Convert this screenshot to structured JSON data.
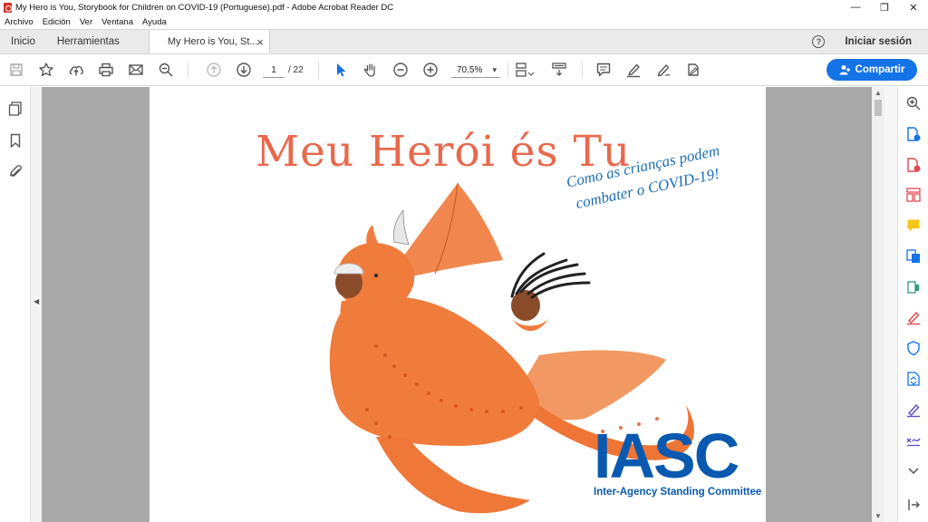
{
  "window": {
    "title": "My Hero is You, Storybook for Children on COVID-19 (Portuguese).pdf - Adobe Acrobat Reader DC",
    "minimize_glyph": "—",
    "restore_glyph": "❐",
    "close_glyph": "✕"
  },
  "menu": [
    "Archivo",
    "Edición",
    "Ver",
    "Ventana",
    "Ayuda"
  ],
  "tabs": {
    "home": "Inicio",
    "tools": "Herramientas",
    "document": "My Hero is You, St...",
    "close_glyph": "×",
    "help_glyph": "?",
    "sign_in": "Iniciar sesión"
  },
  "toolbar": {
    "current_page": "1",
    "page_separator": "/  22",
    "zoom": "70.5%",
    "share_label": "Compartir"
  },
  "icons": {
    "toolbar": [
      "save-icon",
      "bookmark-star-icon",
      "upload-icon",
      "print-icon",
      "email-icon",
      "zoom-search-icon",
      "page-up-icon",
      "page-down-icon",
      "select-arrow-icon",
      "hand-icon",
      "zoom-out-icon",
      "zoom-in-icon",
      "page-fit-icon",
      "scroll-mode-icon",
      "comment-icon",
      "highlight-icon",
      "draw-icon",
      "fill-sign-icon"
    ],
    "left_rail": [
      "page-thumbnails-icon",
      "bookmarks-icon",
      "attachments-icon"
    ],
    "right_rail": [
      "search-icon",
      "export-pdf-icon",
      "create-pdf-icon",
      "organize-pages-icon",
      "comment-icon",
      "combine-files-icon",
      "edit-pdf-icon",
      "fill-sign-icon",
      "protect-icon",
      "compress-icon",
      "send-signature-icon",
      "certify-icon",
      "more-tools-icon",
      "expand-icon"
    ]
  },
  "document": {
    "title": "Meu Herói és Tu",
    "subtitle_line1": "Como as crianças podem",
    "subtitle_line2": "combater o COVID-19!",
    "logo": "IASC",
    "logo_subtitle": "Inter-Agency Standing Committee"
  },
  "colors": {
    "accent": "#1473e6",
    "title_orange": "#e8694c",
    "subtitle_blue": "#1c6fb6",
    "iasc_blue": "#0a59b0"
  }
}
